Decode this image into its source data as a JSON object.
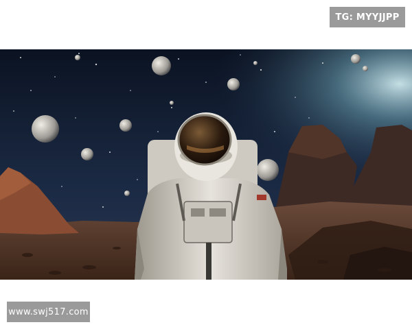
{
  "top_label": "TG: MYYJJPP",
  "bottom_label": "www.swj517.com",
  "image": {
    "subject": "astronaut-on-rocky-planet",
    "colors": {
      "sky_top": "#0c1424",
      "sky_glow": "#7fb8c9",
      "ground": "#5a3b2a",
      "rock": "#8a4d33",
      "suit": "#d9d6cf",
      "visor": "#3a2a18"
    }
  }
}
